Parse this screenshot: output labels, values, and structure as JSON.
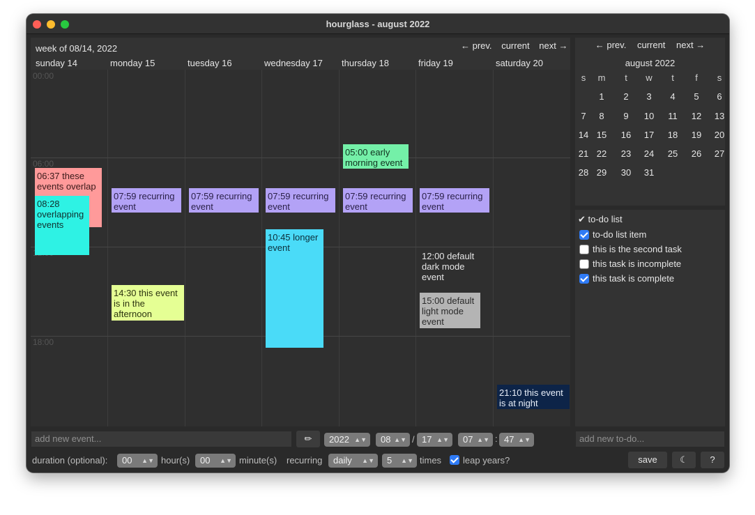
{
  "window": {
    "title": "hourglass  -  august 2022"
  },
  "calendar": {
    "week_label": "week of 08/14, 2022",
    "nav": {
      "prev": "← prev.",
      "current": "current",
      "next": "next →"
    },
    "days": [
      "sunday 14",
      "monday 15",
      "tuesday 16",
      "wednesday 17",
      "thursday 18",
      "friday 19",
      "saturday 20"
    ],
    "hour_labels": [
      "00:00",
      "06:00",
      "12:00",
      "18:00"
    ],
    "events": [
      {
        "day": 0,
        "start": "06:37",
        "text": "06:37 these events overlap",
        "color": "red"
      },
      {
        "day": 0,
        "start": "08:28",
        "text": "08:28 overlapping events",
        "color": "cyan"
      },
      {
        "day": 1,
        "start": "07:59",
        "text": "07:59 recurring event",
        "color": "purple"
      },
      {
        "day": 2,
        "start": "07:59",
        "text": "07:59 recurring event",
        "color": "purple"
      },
      {
        "day": 3,
        "start": "07:59",
        "text": "07:59 recurring event",
        "color": "purple"
      },
      {
        "day": 4,
        "start": "07:59",
        "text": "07:59 recurring event",
        "color": "purple"
      },
      {
        "day": 5,
        "start": "07:59",
        "text": "07:59 recurring event",
        "color": "purple"
      },
      {
        "day": 4,
        "start": "05:00",
        "text": "05:00 early morning event",
        "color": "green"
      },
      {
        "day": 3,
        "start": "10:45",
        "text": "10:45 longer event",
        "color": "blue"
      },
      {
        "day": 1,
        "start": "14:30",
        "text": "14:30 this event is in the afternoon",
        "color": "yellow"
      },
      {
        "day": 5,
        "start": "12:00",
        "text": "12:00 default dark mode event",
        "color": "none"
      },
      {
        "day": 5,
        "start": "15:00",
        "text": "15:00 default light mode event",
        "color": "gray"
      },
      {
        "day": 6,
        "start": "21:10",
        "text": "21:10 this event is at night",
        "color": "navy"
      }
    ]
  },
  "mini_calendar": {
    "nav": {
      "prev": "← prev.",
      "current": "current",
      "next": "next →"
    },
    "month": "august 2022",
    "dow": [
      "s",
      "m",
      "t",
      "w",
      "t",
      "f",
      "s"
    ],
    "weeks": [
      [
        "",
        "1",
        "2",
        "3",
        "4",
        "5",
        "6"
      ],
      [
        "7",
        "8",
        "9",
        "10",
        "11",
        "12",
        "13"
      ],
      [
        "14",
        "15",
        "16",
        "17",
        "18",
        "19",
        "20"
      ],
      [
        "21",
        "22",
        "23",
        "24",
        "25",
        "26",
        "27"
      ],
      [
        "28",
        "29",
        "30",
        "31",
        "",
        "",
        ""
      ]
    ]
  },
  "todo": {
    "title": "✔ to-do list",
    "items": [
      {
        "label": "to-do list item",
        "done": true
      },
      {
        "label": "this is the second task",
        "done": false
      },
      {
        "label": "this task is incomplete",
        "done": false
      },
      {
        "label": "this task is complete",
        "done": true
      }
    ],
    "new_placeholder": "add new to-do..."
  },
  "event_form": {
    "new_placeholder": "add new event...",
    "pencil_icon": "✏",
    "year": "2022",
    "month": "08",
    "date_sep": "/",
    "day": "17",
    "hour": "07",
    "time_sep": ":",
    "minute": "47",
    "duration_label": "duration (optional):",
    "duration_hours": "00",
    "hours_label": "hour(s)",
    "duration_minutes": "00",
    "minutes_label": "minute(s)",
    "recurring_label": "recurring",
    "recurring_value": "daily",
    "times_value": "5",
    "times_label": "times",
    "leap_label": "leap years?",
    "leap_checked": true
  },
  "buttons": {
    "save": "save",
    "theme": "☾",
    "help": "?"
  },
  "colors": {
    "red": "#ff9a9a",
    "cyan": "#2ef2e4",
    "purple": "#b3a2f6",
    "green": "#74f0a8",
    "blue": "#4adbf8",
    "yellow": "#e5ff94",
    "gray": "#b4b4b4",
    "navy": "#0d2448"
  }
}
